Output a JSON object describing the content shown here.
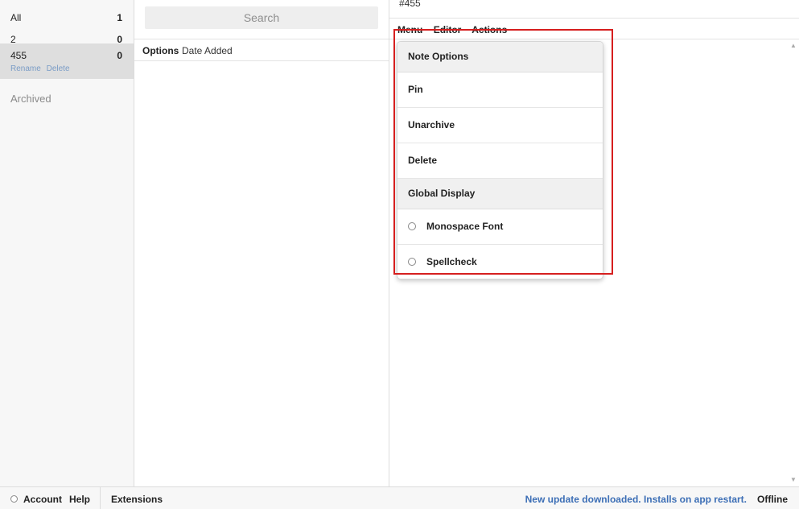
{
  "tags": {
    "items": [
      {
        "name": "All",
        "count": "1"
      },
      {
        "name": "2",
        "count": "0"
      },
      {
        "name": "455",
        "count": "0",
        "actions": [
          "Rename",
          "Delete"
        ]
      }
    ],
    "archived": "Archived"
  },
  "notes": {
    "search_placeholder": "Search",
    "header_options": "Options",
    "header_sort": "Date Added"
  },
  "editor": {
    "note_title": "#455",
    "menu": [
      "Menu",
      "Editor",
      "Actions"
    ]
  },
  "dropdown": {
    "section1": "Note Options",
    "pin": "Pin",
    "unarchive": "Unarchive",
    "delete": "Delete",
    "section2": "Global Display",
    "monospace": "Monospace Font",
    "spellcheck": "Spellcheck"
  },
  "footer": {
    "account": "Account",
    "help": "Help",
    "extensions": "Extensions",
    "update": "New update downloaded. Installs on app restart.",
    "status": "Offline"
  },
  "colors": {
    "accent_link": "#3d6fb6",
    "annotation": "#d61f1f"
  }
}
